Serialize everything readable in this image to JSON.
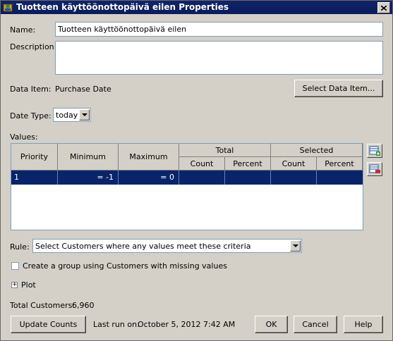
{
  "window": {
    "title": "Tuotteen käyttöönottopäivä eilen Properties"
  },
  "form": {
    "name_label": "Name:",
    "name_value": "Tuotteen käyttöönottopäivä eilen",
    "description_label": "Description:",
    "description_value": "",
    "data_item_label": "Data Item:",
    "data_item_value": "Purchase Date",
    "select_data_item_button": "Select Data Item...",
    "date_type_label": "Date Type:",
    "date_type_value": "today",
    "values_label": "Values:"
  },
  "table": {
    "headers": {
      "priority": "Priority",
      "minimum": "Minimum",
      "maximum": "Maximum",
      "total": "Total",
      "selected": "Selected",
      "count": "Count",
      "percent": "Percent"
    },
    "rows": [
      {
        "priority": "1",
        "minimum": "= -1",
        "maximum": "= 0",
        "total_count": "",
        "total_percent": "",
        "selected_count": "",
        "selected_percent": ""
      }
    ]
  },
  "rule": {
    "label": "Rule:",
    "value": "Select Customers where any values meet these criteria"
  },
  "missing_group": {
    "label": "Create a group using Customers with missing values",
    "checked": false
  },
  "plot": {
    "label": "Plot"
  },
  "totals": {
    "label": "Total Customers:",
    "value": "6,960"
  },
  "footer": {
    "update_counts": "Update Counts",
    "last_run_label": "Last run on:",
    "last_run_value": "October 5, 2012 7:42 AM",
    "ok": "OK",
    "cancel": "Cancel",
    "help": "Help"
  },
  "colors": {
    "title_bar": "#0a246a",
    "selection": "#0a246a",
    "dialog_bg": "#d4d0c8"
  },
  "icons": [
    "app-icon",
    "close-icon",
    "add-row-icon",
    "edit-row-icon",
    "dropdown-arrow-icon",
    "expand-plus-icon"
  ]
}
